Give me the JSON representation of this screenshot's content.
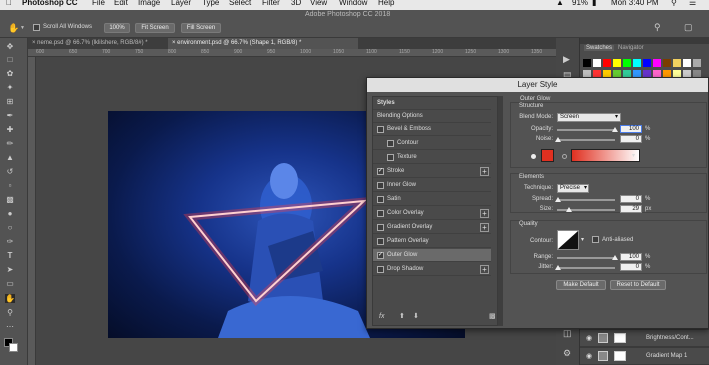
{
  "menubar": {
    "app": "Photoshop CC",
    "items": [
      "File",
      "Edit",
      "Image",
      "Layer",
      "Type",
      "Select",
      "Filter",
      "3D",
      "View",
      "Window",
      "Help"
    ],
    "battery": "91%",
    "clock": "Mon 3:40 PM"
  },
  "optionsbar": {
    "scroll_all_windows": "Scroll All Windows",
    "zoom": "100%",
    "fit_screen": "Fit Screen",
    "fill_screen": "Fill Screen",
    "app_title": "Adobe Photoshop CC 2018"
  },
  "tabs": [
    {
      "label": "neme.psd @ 66.7% (lklilshere, RGB/8#) *"
    },
    {
      "label": "environment.psd @ 66.7% (Shape 1, RGB/8) *"
    }
  ],
  "ruler_top": [
    "600",
    "650",
    "700",
    "750",
    "800",
    "850",
    "900",
    "950",
    "1000",
    "1050",
    "1100",
    "1150",
    "1200",
    "1250",
    "1300",
    "1350"
  ],
  "panels": {
    "tab1": "Swatches",
    "tab2": "Navigator",
    "swatch_colors": [
      "#000000",
      "#ffffff",
      "#ff0000",
      "#ffff00",
      "#00ff00",
      "#00ffff",
      "#0000ff",
      "#ff00ff",
      "#7a3d00",
      "#f0d060",
      "#ffffff",
      "#aaaaaa",
      "#c0c0c0",
      "#ff3333",
      "#ffcc00",
      "#66cc33",
      "#33cc99",
      "#3399ff",
      "#6633cc",
      "#ff66cc",
      "#ff9900",
      "#ffff99",
      "#cccccc",
      "#888888"
    ],
    "layers": [
      {
        "name": "Brightness/Cont..."
      },
      {
        "name": "Gradient Map 1"
      }
    ]
  },
  "dialog": {
    "title": "Layer Style",
    "styles_header": "Styles",
    "blending": "Blending Options",
    "items": [
      {
        "label": "Bevel & Emboss",
        "checked": false,
        "plus": false,
        "indent": false
      },
      {
        "label": "Contour",
        "checked": false,
        "plus": false,
        "indent": true
      },
      {
        "label": "Texture",
        "checked": false,
        "plus": false,
        "indent": true
      },
      {
        "label": "Stroke",
        "checked": true,
        "plus": true,
        "indent": false
      },
      {
        "label": "Inner Glow",
        "checked": false,
        "plus": false,
        "indent": false
      },
      {
        "label": "Satin",
        "checked": false,
        "plus": false,
        "indent": false
      },
      {
        "label": "Color Overlay",
        "checked": false,
        "plus": true,
        "indent": false
      },
      {
        "label": "Gradient Overlay",
        "checked": false,
        "plus": true,
        "indent": false
      },
      {
        "label": "Pattern Overlay",
        "checked": false,
        "plus": false,
        "indent": false
      },
      {
        "label": "Outer Glow",
        "checked": true,
        "plus": false,
        "indent": false
      },
      {
        "label": "Drop Shadow",
        "checked": false,
        "plus": true,
        "indent": false
      }
    ],
    "fx_label": "fx",
    "outer_glow_title": "Outer Glow",
    "structure": {
      "title": "Structure",
      "blend_mode_label": "Blend Mode:",
      "blend_mode": "Screen",
      "opacity_label": "Opacity:",
      "opacity": "100",
      "noise_label": "Noise:",
      "noise": "0",
      "glow_color": "#e03020"
    },
    "elements": {
      "title": "Elements",
      "technique_label": "Technique:",
      "technique": "Precise",
      "spread_label": "Spread:",
      "spread": "0",
      "size_label": "Size:",
      "size": "29",
      "size_unit": "px"
    },
    "quality": {
      "title": "Quality",
      "contour_label": "Contour:",
      "anti_aliased": "Anti-aliased",
      "range_label": "Range:",
      "range": "100",
      "jitter_label": "Jitter:",
      "jitter": "0"
    },
    "make_default": "Make Default",
    "reset_default": "Reset to Default",
    "percent": "%"
  }
}
